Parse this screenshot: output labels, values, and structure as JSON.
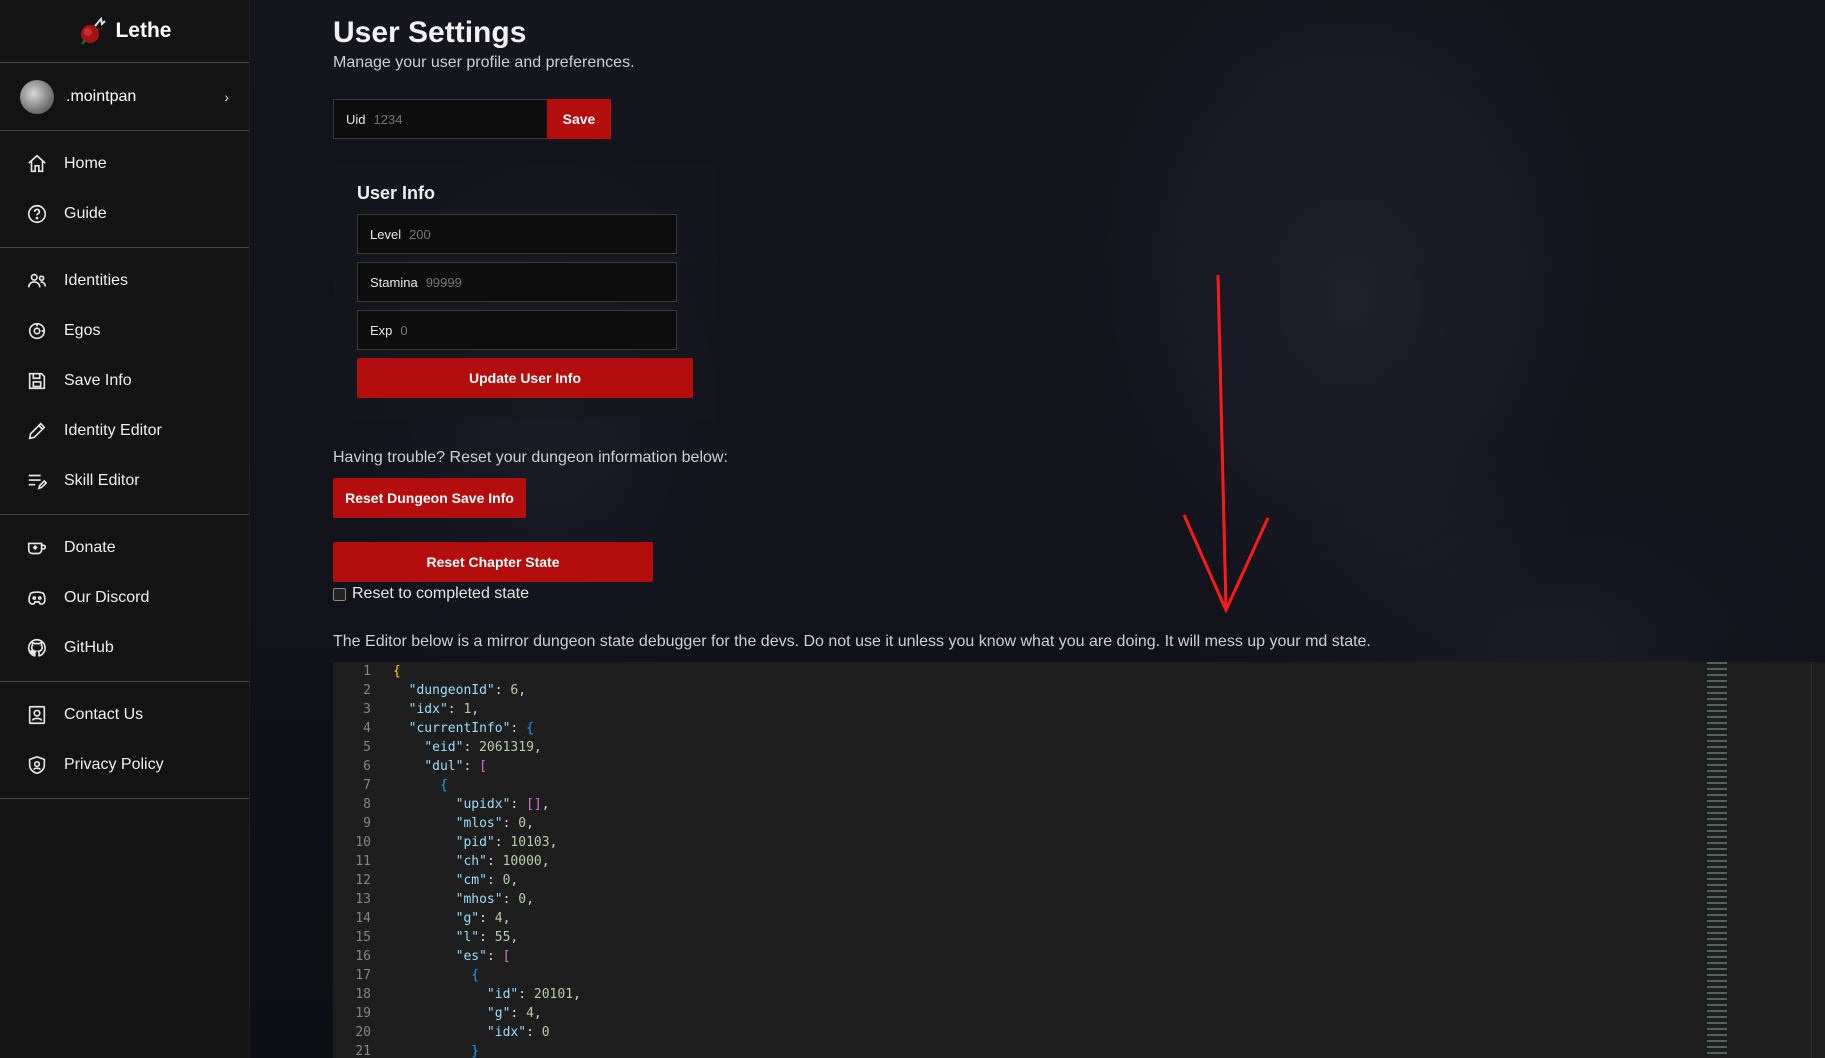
{
  "app": {
    "name": "Lethe"
  },
  "user": {
    "name": ".mointpan"
  },
  "sidebar": {
    "groups": [
      [
        {
          "label": "Home",
          "icon": "home-icon"
        },
        {
          "label": "Guide",
          "icon": "help-circle-icon"
        }
      ],
      [
        {
          "label": "Identities",
          "icon": "users-icon"
        },
        {
          "label": "Egos",
          "icon": "ego-icon"
        },
        {
          "label": "Save Info",
          "icon": "save-icon"
        },
        {
          "label": "Identity Editor",
          "icon": "pencil-icon"
        },
        {
          "label": "Skill Editor",
          "icon": "list-edit-icon"
        }
      ],
      [
        {
          "label": "Donate",
          "icon": "kofi-icon"
        },
        {
          "label": "Our Discord",
          "icon": "discord-icon"
        },
        {
          "label": "GitHub",
          "icon": "github-icon"
        }
      ],
      [
        {
          "label": "Contact Us",
          "icon": "contact-icon"
        },
        {
          "label": "Privacy Policy",
          "icon": "shield-icon"
        }
      ]
    ]
  },
  "page": {
    "title": "User Settings",
    "subtitle": "Manage your user profile and preferences."
  },
  "uid": {
    "label": "Uid",
    "placeholder": "1234",
    "save_label": "Save"
  },
  "user_info": {
    "title": "User Info",
    "fields": [
      {
        "label": "Level",
        "placeholder": "200"
      },
      {
        "label": "Stamina",
        "placeholder": "99999"
      },
      {
        "label": "Exp",
        "placeholder": "0"
      }
    ],
    "update_label": "Update User Info"
  },
  "reset": {
    "trouble_text": "Having trouble? Reset your dungeon information below:",
    "dungeon_label": "Reset Dungeon Save Info",
    "chapter_label": "Reset Chapter State",
    "checkbox_label": "Reset to completed state",
    "checkbox_checked": false
  },
  "editor": {
    "warning": "The Editor below is a mirror dungeon state debugger for the devs. Do not use it unless you know what you are doing. It will mess up your md state.",
    "lines": [
      "{",
      "  \"dungeonId\": 6,",
      "  \"idx\": 1,",
      "  \"currentInfo\": {",
      "    \"eid\": 2061319,",
      "    \"dul\": [",
      "      {",
      "        \"upidx\": [],",
      "        \"mlos\": 0,",
      "        \"pid\": 10103,",
      "        \"ch\": 10000,",
      "        \"cm\": 0,",
      "        \"mhos\": 0,",
      "        \"g\": 4,",
      "        \"l\": 55,",
      "        \"es\": [",
      "          {",
      "            \"id\": 20101,",
      "            \"g\": 4,",
      "            \"idx\": 0",
      "          }"
    ]
  },
  "colors": {
    "accent": "#b30d0d",
    "sidebar_bg": "#131313",
    "editor_bg": "#1e1e1e",
    "annotation": "#ff1a1a"
  }
}
